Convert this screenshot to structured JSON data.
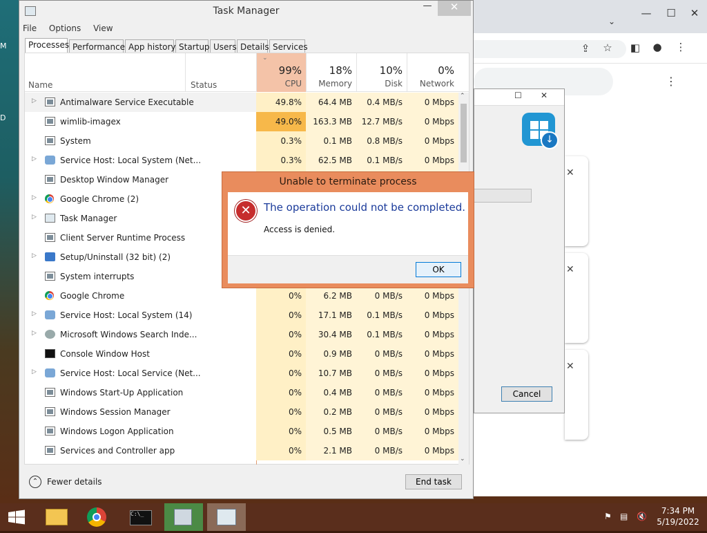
{
  "task_manager": {
    "title": "Task Manager",
    "menu": [
      "File",
      "Options",
      "View"
    ],
    "tabs": [
      "Processes",
      "Performance",
      "App history",
      "Startup",
      "Users",
      "Details",
      "Services"
    ],
    "columns": {
      "name": "Name",
      "status": "Status",
      "cpu": {
        "pct": "99%",
        "label": "CPU"
      },
      "memory": {
        "pct": "18%",
        "label": "Memory"
      },
      "disk": {
        "pct": "10%",
        "label": "Disk"
      },
      "network": {
        "pct": "0%",
        "label": "Network"
      }
    },
    "processes": [
      {
        "name": "Antimalware Service Executable",
        "expand": true,
        "icon": "window-icon",
        "cpu": "49.8%",
        "mem": "64.4 MB",
        "disk": "0.4 MB/s",
        "net": "0 Mbps"
      },
      {
        "name": "wimlib-imagex",
        "expand": false,
        "icon": "window-icon",
        "cpu": "49.0%",
        "mem": "163.3 MB",
        "disk": "12.7 MB/s",
        "net": "0 Mbps"
      },
      {
        "name": "System",
        "expand": false,
        "icon": "window-icon",
        "cpu": "0.3%",
        "mem": "0.1 MB",
        "disk": "0.8 MB/s",
        "net": "0 Mbps"
      },
      {
        "name": "Service Host: Local System (Net...",
        "expand": true,
        "icon": "gear-icon",
        "cpu": "0.3%",
        "mem": "62.5 MB",
        "disk": "0.1 MB/s",
        "net": "0 Mbps"
      },
      {
        "name": "Desktop Window Manager",
        "expand": false,
        "icon": "window-icon",
        "cpu": "",
        "mem": "",
        "disk": "",
        "net": ""
      },
      {
        "name": "Google Chrome (2)",
        "expand": true,
        "icon": "chrome-icon",
        "cpu": "",
        "mem": "",
        "disk": "",
        "net": ""
      },
      {
        "name": "Task Manager",
        "expand": true,
        "icon": "task-manager-icon",
        "cpu": "",
        "mem": "",
        "disk": "",
        "net": ""
      },
      {
        "name": "Client Server Runtime Process",
        "expand": false,
        "icon": "window-icon",
        "cpu": "",
        "mem": "",
        "disk": "",
        "net": ""
      },
      {
        "name": "Setup/Uninstall (32 bit) (2)",
        "expand": true,
        "icon": "setup-icon",
        "cpu": "",
        "mem": "",
        "disk": "",
        "net": ""
      },
      {
        "name": "System interrupts",
        "expand": false,
        "icon": "window-icon",
        "cpu": "",
        "mem": "",
        "disk": "",
        "net": ""
      },
      {
        "name": "Google Chrome",
        "expand": false,
        "icon": "chrome-icon",
        "cpu": "0%",
        "mem": "6.2 MB",
        "disk": "0 MB/s",
        "net": "0 Mbps"
      },
      {
        "name": "Service Host: Local System (14)",
        "expand": true,
        "icon": "gear-icon",
        "cpu": "0%",
        "mem": "17.1 MB",
        "disk": "0.1 MB/s",
        "net": "0 Mbps"
      },
      {
        "name": "Microsoft Windows Search Inde...",
        "expand": true,
        "icon": "search-indexer-icon",
        "cpu": "0%",
        "mem": "30.4 MB",
        "disk": "0.1 MB/s",
        "net": "0 Mbps"
      },
      {
        "name": "Console Window Host",
        "expand": false,
        "icon": "console-icon",
        "cpu": "0%",
        "mem": "0.9 MB",
        "disk": "0 MB/s",
        "net": "0 Mbps"
      },
      {
        "name": "Service Host: Local Service (Net...",
        "expand": true,
        "icon": "gear-icon",
        "cpu": "0%",
        "mem": "10.7 MB",
        "disk": "0 MB/s",
        "net": "0 Mbps"
      },
      {
        "name": "Windows Start-Up Application",
        "expand": false,
        "icon": "window-icon",
        "cpu": "0%",
        "mem": "0.4 MB",
        "disk": "0 MB/s",
        "net": "0 Mbps"
      },
      {
        "name": "Windows Session Manager",
        "expand": false,
        "icon": "window-icon",
        "cpu": "0%",
        "mem": "0.2 MB",
        "disk": "0 MB/s",
        "net": "0 Mbps"
      },
      {
        "name": "Windows Logon Application",
        "expand": false,
        "icon": "window-icon",
        "cpu": "0%",
        "mem": "0.5 MB",
        "disk": "0 MB/s",
        "net": "0 Mbps"
      },
      {
        "name": "Services and Controller app",
        "expand": false,
        "icon": "window-icon",
        "cpu": "0%",
        "mem": "2.1 MB",
        "disk": "0 MB/s",
        "net": "0 Mbps"
      }
    ],
    "fewer_details": "Fewer details",
    "end_task": "End task"
  },
  "error_dialog": {
    "title": "Unable to terminate process",
    "message": "The operation could not be completed.",
    "detail": "Access is denied.",
    "ok": "OK"
  },
  "setup_dialog": {
    "cancel": "Cancel"
  },
  "taskbar": {
    "time": "7:34 PM",
    "date": "5/19/2022",
    "pinned": [
      "file-explorer-icon",
      "chrome-icon",
      "command-prompt-icon",
      "setup-icon",
      "task-manager-icon"
    ]
  },
  "colors": {
    "cpu_hot": "#f7b84a",
    "cpu_col": "#fff0c6",
    "mem_col": "#fff4d6",
    "header_hot": "#f4c3a8",
    "error_frame": "#e98c5d",
    "taskbar": "#5a2e1c"
  }
}
